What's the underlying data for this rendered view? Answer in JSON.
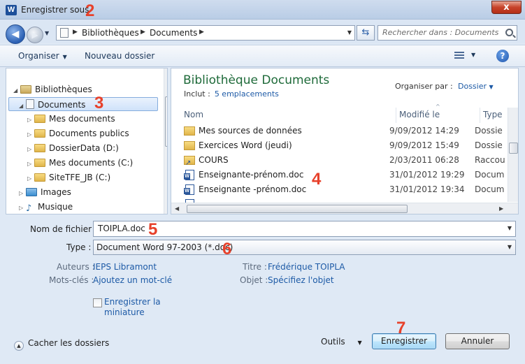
{
  "window": {
    "title": "Enregistrer sous",
    "app_icon": "word-icon",
    "close_label": "x"
  },
  "address": {
    "segments": [
      "Bibliothèques",
      "Documents"
    ],
    "search_placeholder": "Rechercher dans : Documents"
  },
  "toolbar": {
    "organize": "Organiser",
    "new_folder": "Nouveau dossier",
    "help": "?"
  },
  "nav": {
    "items": [
      {
        "label": "Bibliothèques",
        "icon": "library-icon"
      },
      {
        "label": "Documents",
        "icon": "documents-library-icon",
        "selected": true
      },
      {
        "label": "Mes documents",
        "icon": "folder-icon"
      },
      {
        "label": "Documents publics",
        "icon": "folder-icon"
      },
      {
        "label": "DossierData (D:)",
        "icon": "folder-icon"
      },
      {
        "label": "Mes documents (C:)",
        "icon": "folder-icon"
      },
      {
        "label": "SiteTFE_JB (C:)",
        "icon": "folder-icon"
      },
      {
        "label": "Images",
        "icon": "images-library-icon"
      },
      {
        "label": "Musique",
        "icon": "music-library-icon"
      }
    ]
  },
  "files": {
    "library_title": "Bibliothèque Documents",
    "include_label": "Inclut :",
    "include_link": "5 emplacements",
    "arrange_label": "Organiser par :",
    "arrange_value": "Dossier",
    "columns": {
      "name": "Nom",
      "modified": "Modifié le",
      "type": "Type"
    },
    "rows": [
      {
        "name": "Mes sources de données",
        "date": "9/09/2012 14:29",
        "type": "Dossie",
        "icon": "data-folder-icon"
      },
      {
        "name": "Exercices Word (jeudi)",
        "date": "9/09/2012 15:49",
        "type": "Dossie",
        "icon": "folder-icon"
      },
      {
        "name": "COURS",
        "date": "2/03/2011 06:28",
        "type": "Raccou",
        "icon": "shortcut-folder-icon"
      },
      {
        "name": "Enseignante-prénom.doc",
        "date": "31/01/2012 19:29",
        "type": "Docum",
        "icon": "word-doc-icon"
      },
      {
        "name": "Enseignante -prénom.doc",
        "date": "31/01/2012 19:34",
        "type": "Docum",
        "icon": "word-doc-icon"
      }
    ]
  },
  "form": {
    "filename_label": "Nom de fichier :",
    "filename_value": "TOIPLA.doc",
    "type_label": "Type :",
    "type_value": "Document Word 97-2003 (*.doc)",
    "authors_label": "Auteurs :",
    "authors_value": "IEPS Libramont",
    "keywords_label": "Mots-clés :",
    "keywords_value": "Ajoutez un mot-clé",
    "title_label": "Titre :",
    "title_value": "Frédérique TOIPLA",
    "subject_label": "Objet :",
    "subject_value": "Spécifiez l'objet",
    "thumb_line1": "Enregistrer la",
    "thumb_line2": "miniature"
  },
  "footer": {
    "hide_folders": "Cacher les dossiers",
    "tools": "Outils",
    "save": "Enregistrer",
    "cancel": "Annuler"
  },
  "annotations": [
    "2",
    "3",
    "4",
    "5",
    "6",
    "7"
  ]
}
